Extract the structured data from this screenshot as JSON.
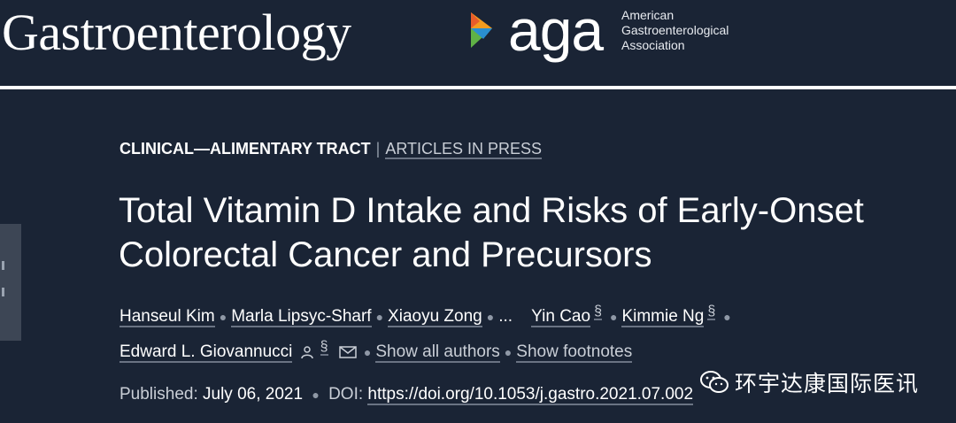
{
  "header": {
    "journal_title": "Gastroenterology",
    "aga_wordmark": "aga",
    "aga_full_name_lines": [
      "American",
      "Gastroenterological",
      "Association"
    ]
  },
  "article": {
    "category": "CLINICAL—ALIMENTARY TRACT",
    "category_separator": "|",
    "status": "ARTICLES IN PRESS",
    "title_line1": "Total Vitamin D Intake and Risks of Early-Onset",
    "title_line2": "Colorectal Cancer and Precursors",
    "authors": [
      "Hanseul Kim",
      "Marla Lipsyc-Sharf",
      "Xiaoyu Zong",
      "...",
      "Yin Cao",
      "Kimmie Ng",
      "Edward L. Giovannucci"
    ],
    "section_mark": "§",
    "show_all_authors": "Show all authors",
    "show_footnotes": "Show footnotes",
    "published_label": "Published:",
    "published_date": "July 06, 2021",
    "doi_label": "DOI:",
    "doi_url": "https://doi.org/10.1053/j.gastro.2021.07.002"
  },
  "watermark": {
    "text": "环宇达康国际医讯",
    "icon": "wechat-icon"
  },
  "colors": {
    "background": "#1a2435",
    "divider": "#ffffff",
    "underline": "#6a7383",
    "logo_orange": "#f39c1f",
    "logo_blue": "#2a8fd0",
    "logo_green": "#5fb246"
  }
}
